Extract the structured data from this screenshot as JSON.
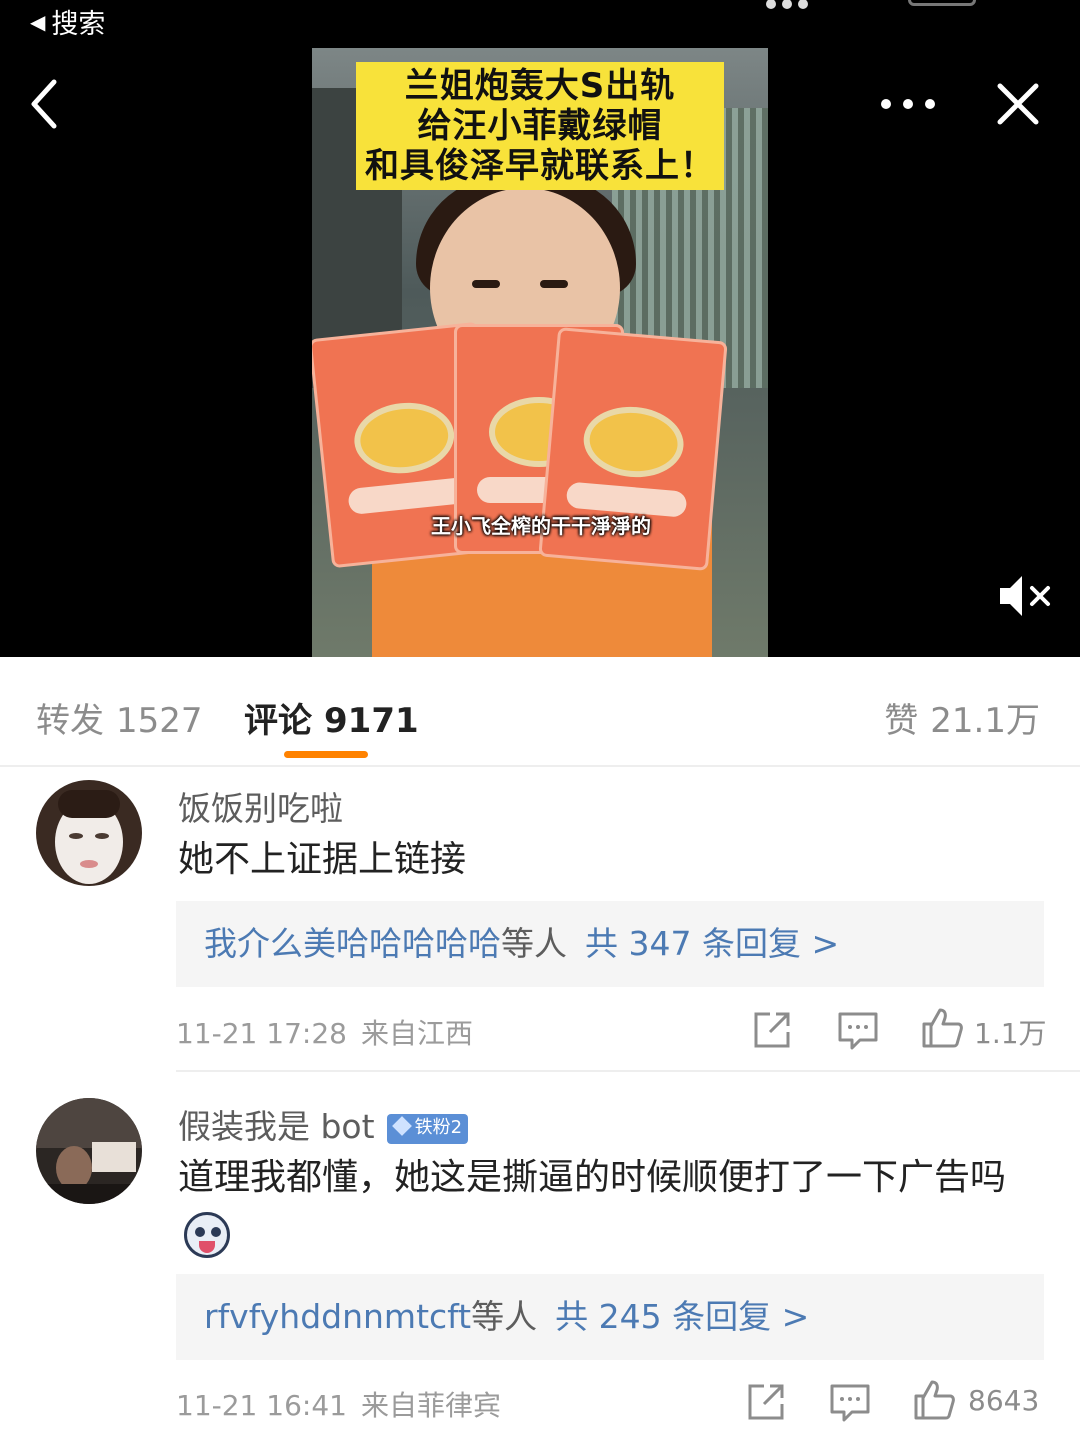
{
  "status_bar": {
    "back_app_label": "搜索"
  },
  "video": {
    "caption_lines": [
      "兰姐炮轰大S出轨",
      "给汪小菲戴绿帽",
      "和具俊泽早就联系上！"
    ],
    "subtitle": "王小飞全榨的干干淨淨的"
  },
  "tabs": {
    "repost": {
      "label": "转发",
      "count": "1527"
    },
    "comments": {
      "label": "评论",
      "count": "9171"
    },
    "likes": {
      "label": "赞",
      "count": "21.1万"
    }
  },
  "comments": [
    {
      "author": "饭饭别吃啦",
      "text": "她不上证据上链接",
      "reply_preview": {
        "names": "我介么美哈哈哈哈哈",
        "etc": "等人",
        "total": "共 347 条回复 >"
      },
      "time": "11-21 17:28",
      "location": "来自江西",
      "likes": "1.1万"
    },
    {
      "author": "假装我是 bot",
      "badge": "铁粉2",
      "text": "道理我都懂，她这是撕逼的时候顺便打了一下广告吗",
      "reply_preview": {
        "names": "rfvfyhddnnmtcft",
        "etc": "等人",
        "total": "共 245 条回复 >"
      },
      "time": "11-21 16:41",
      "location": "来自菲律宾",
      "likes": "8643"
    }
  ],
  "colors": {
    "accent": "#ff8200",
    "link": "#4c7ab3",
    "badge": "#5b8fd6",
    "caption_bg": "#f8e23a"
  }
}
